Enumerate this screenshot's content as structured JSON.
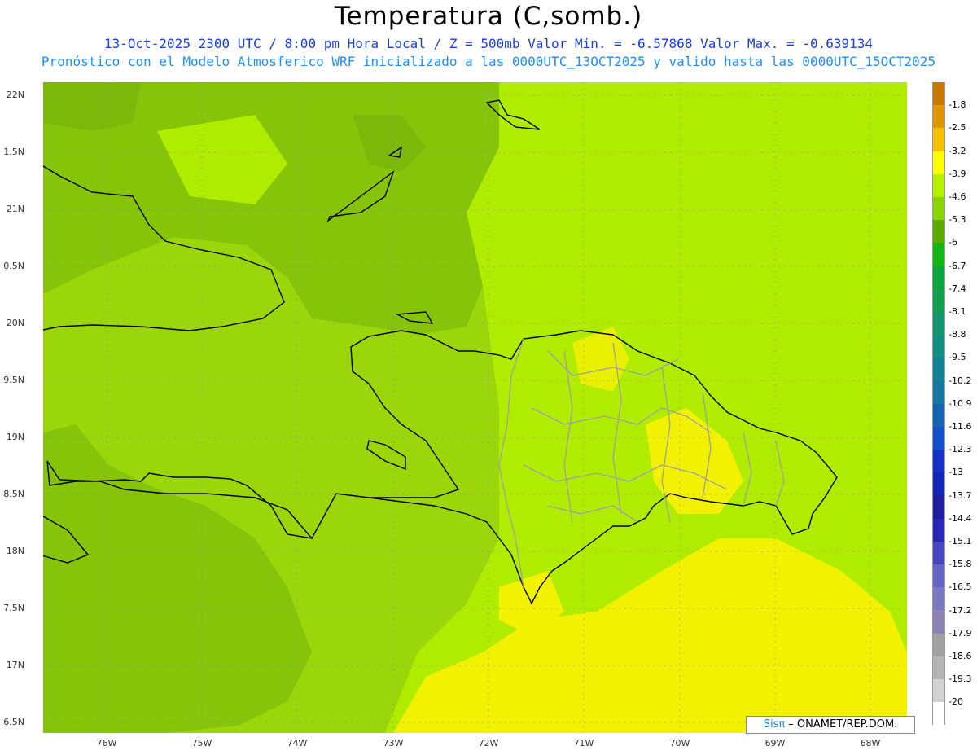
{
  "header": {
    "title": "Temperatura (C,somb.)",
    "line1": "13-Oct-2025  2300 UTC / 8:00 pm Hora Local / Z = 500mb  Valor Min. = -6.57868  Valor Max. = -0.639134",
    "line2": "Pronóstico con el Modelo Atmosferico WRF inicializado a las 0000UTC_13OCT2025 y valido hasta las  0000UTC_15OCT2025"
  },
  "map": {
    "lat_labels": [
      "22N",
      "1.5N",
      "21N",
      "0.5N",
      "20N",
      "9.5N",
      "19N",
      "8.5N",
      "18N",
      "7.5N",
      "17N",
      "6.5N"
    ],
    "lon_labels": [
      "76W",
      "75W",
      "74W",
      "73W",
      "72W",
      "71W",
      "70W",
      "69W",
      "68W"
    ],
    "colors": {
      "base": "#9ad60a",
      "darker": "#7cb80a",
      "lighter": "#b4f000",
      "yellow": "#f2f200",
      "coast": "#000000",
      "borders": "#a0a0a0"
    }
  },
  "colorbar": {
    "labels": [
      "-1.8",
      "-2.5",
      "-3.2",
      "-3.9",
      "-4.6",
      "-5.3",
      "-6",
      "-6.7",
      "-7.4",
      "-8.1",
      "-8.8",
      "-9.5",
      "-10.2",
      "-10.9",
      "-11.6",
      "-12.3",
      "-13",
      "-13.7",
      "-14.4",
      "-15.1",
      "-15.8",
      "-16.5",
      "-17.2",
      "-17.9",
      "-18.6",
      "-19.3",
      "-20"
    ],
    "colors": [
      "#c87800",
      "#e09600",
      "#f5c000",
      "#ffff00",
      "#b4f000",
      "#8cd200",
      "#5aaa00",
      "#14b414",
      "#0aa53c",
      "#12a050",
      "#10966e",
      "#109082",
      "#108294",
      "#1478a0",
      "#1464b4",
      "#1450c8",
      "#1432c8",
      "#1428b4",
      "#1e1ea0",
      "#2828b4",
      "#4646c0",
      "#6464c8",
      "#7878c0",
      "#8c82b4",
      "#a0a0a0",
      "#b4b4b4",
      "#d2d2d2",
      "#ffffff"
    ]
  },
  "credit": {
    "logo": "Sisπ",
    "text": " – ONAMET/REP.DOM."
  }
}
